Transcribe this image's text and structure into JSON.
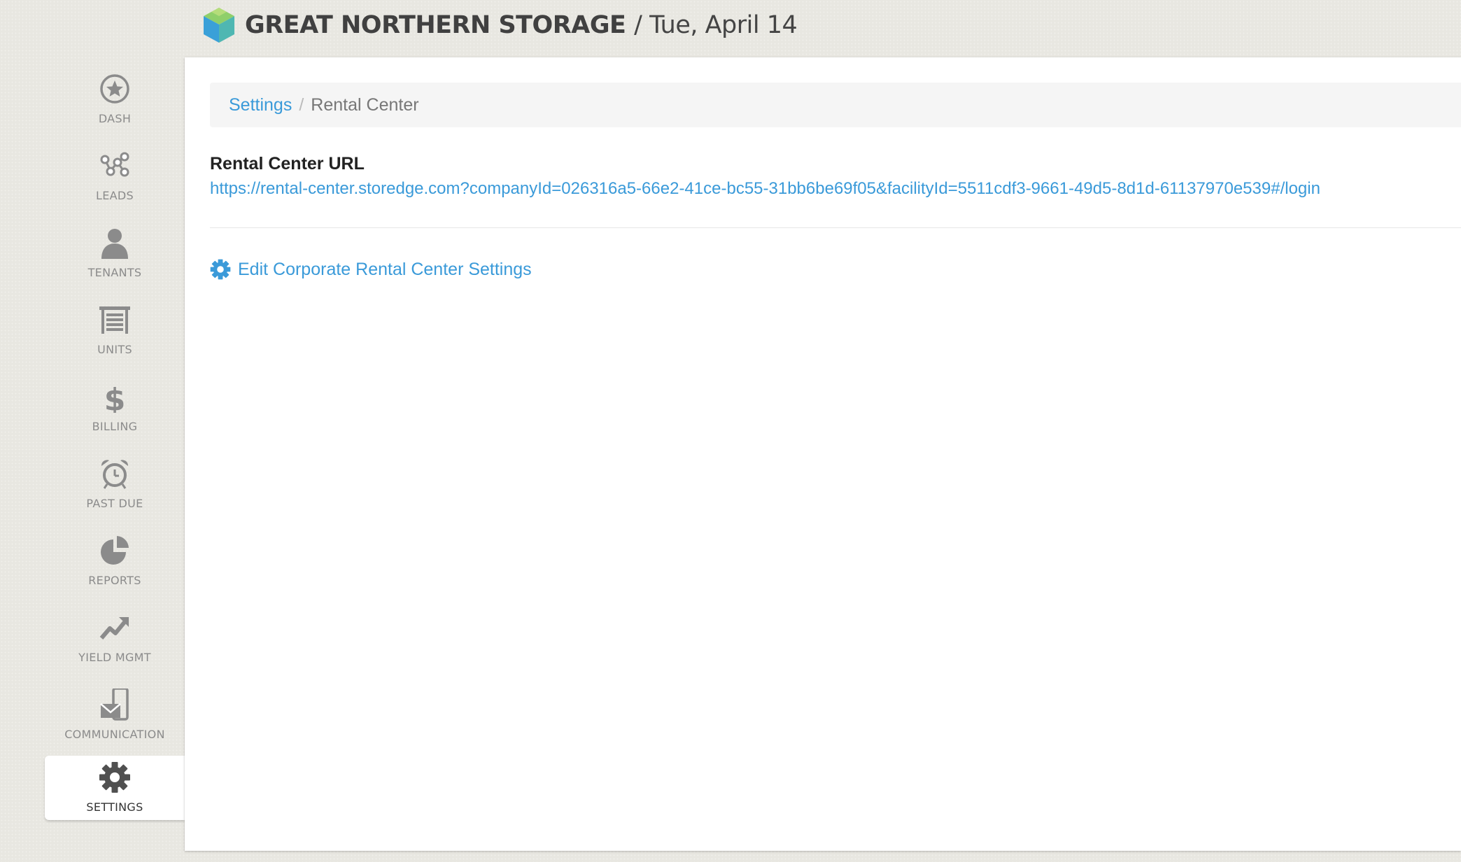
{
  "header": {
    "brand": "GREAT NORTHERN STORAGE",
    "date": "/ Tue, April 14"
  },
  "sidebar": {
    "items": [
      {
        "label": "DASH",
        "icon": "star-icon"
      },
      {
        "label": "LEADS",
        "icon": "network-icon"
      },
      {
        "label": "TENANTS",
        "icon": "person-icon"
      },
      {
        "label": "UNITS",
        "icon": "storage-unit-icon"
      },
      {
        "label": "BILLING",
        "icon": "dollar-icon"
      },
      {
        "label": "PAST DUE",
        "icon": "alarm-clock-icon"
      },
      {
        "label": "REPORTS",
        "icon": "pie-chart-icon"
      },
      {
        "label": "YIELD MGMT",
        "icon": "trending-up-icon"
      },
      {
        "label": "COMMUNICATION",
        "icon": "phone-envelope-icon"
      },
      {
        "label": "SETTINGS",
        "icon": "gear-icon",
        "active": true
      }
    ]
  },
  "breadcrumb": {
    "parent": "Settings",
    "separator": "/",
    "current": "Rental Center"
  },
  "rental_center": {
    "label": "Rental Center URL",
    "url": "https://rental-center.storedge.com?companyId=026316a5-66e2-41ce-bc55-31bb6be69f05&facilityId=5511cdf3-9661-49d5-8d1d-61137970e539#/login"
  },
  "edit_link": {
    "label": "Edit Corporate Rental Center Settings"
  },
  "colors": {
    "link": "#3a9ad9",
    "icon_gray": "#8b8b8b",
    "background": "#e8e7e1"
  }
}
